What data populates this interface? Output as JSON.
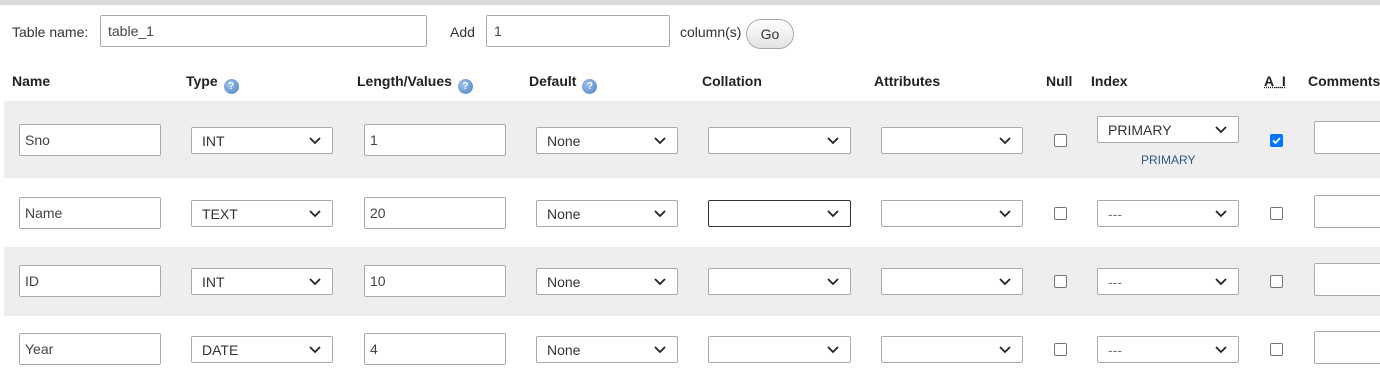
{
  "toolbar": {
    "table_name_label": "Table name:",
    "table_name_value": "table_1",
    "add_label": "Add",
    "add_value": "1",
    "columns_label": "column(s)",
    "go_label": "Go"
  },
  "headers": {
    "name": "Name",
    "type": "Type",
    "length": "Length/Values",
    "default": "Default",
    "collation": "Collation",
    "attributes": "Attributes",
    "null": "Null",
    "index": "Index",
    "ai": "A_I",
    "comments": "Comments"
  },
  "rows": [
    {
      "name": "Sno",
      "type": "INT",
      "length": "1",
      "default": "None",
      "collation": "",
      "attributes": "",
      "null": false,
      "index": "PRIMARY",
      "index_note": "PRIMARY",
      "ai": true
    },
    {
      "name": "Name",
      "type": "TEXT",
      "length": "20",
      "default": "None",
      "collation": "",
      "attributes": "",
      "null": false,
      "index": "---",
      "index_note": "",
      "ai": false
    },
    {
      "name": "ID",
      "type": "INT",
      "length": "10",
      "default": "None",
      "collation": "",
      "attributes": "",
      "null": false,
      "index": "---",
      "index_note": "",
      "ai": false
    },
    {
      "name": "Year",
      "type": "DATE",
      "length": "4",
      "default": "None",
      "collation": "",
      "attributes": "",
      "null": false,
      "index": "---",
      "index_note": "",
      "ai": false
    }
  ],
  "colors": {
    "row_shade": "#eeeeee",
    "checkbox_checked": "#0075ff",
    "help_icon": "#4a7fc1"
  },
  "icons": {
    "help": "help-circle-icon",
    "dropdown": "chevron-down-icon"
  }
}
